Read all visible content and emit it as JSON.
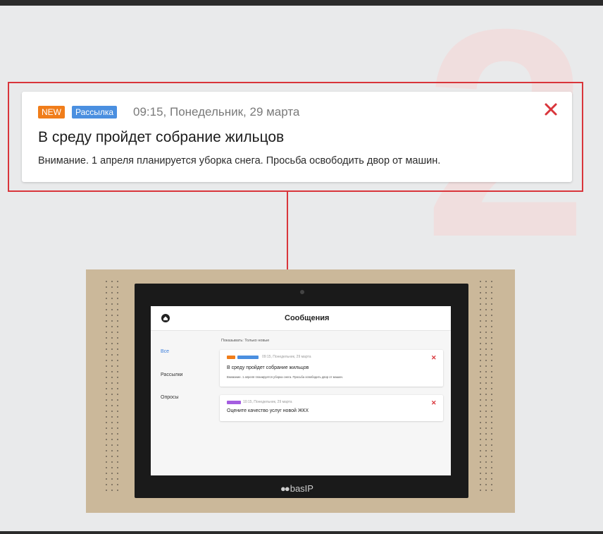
{
  "step_number": "2",
  "callout": {
    "badge_new": "NEW",
    "badge_category": "Рассылка",
    "time": "09:15, Понедельник, 29 марта",
    "title": "В среду пройдет собрание жильцов",
    "body": "Внимание. 1 апреля планируется уборка снега. Просьба освободить двор от машин."
  },
  "device": {
    "logo_text": "basIP",
    "screen": {
      "title": "Сообщения",
      "filter_label": "Показывать: Только новые",
      "sidebar": [
        {
          "label": "Все",
          "active": true
        },
        {
          "label": "Рассылки",
          "active": false
        },
        {
          "label": "Опросы",
          "active": false
        }
      ],
      "messages": [
        {
          "time": "09:15, Понедельник, 29 марта",
          "title": "В среду пройдет собрание жильцов",
          "body": "Внимание. 1 апреля планируется уборка снега. Просьба освободить двор от машин."
        },
        {
          "time": "10:15, Понедельник, 29 марта",
          "title": "Оцените качество услуг новой ЖКХ"
        }
      ]
    }
  },
  "colors": {
    "accent_red": "#d9353b",
    "badge_new": "#f07d1a",
    "badge_category": "#4a8fe0",
    "badge_poll": "#a45de0",
    "device_body": "#cbb89a",
    "bezel": "#1a1a1a"
  },
  "icons": {
    "close": "close-icon",
    "home": "home-icon"
  }
}
